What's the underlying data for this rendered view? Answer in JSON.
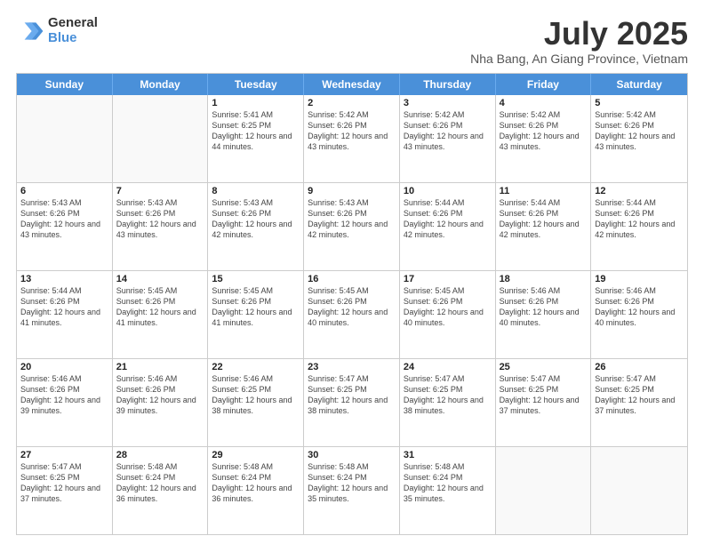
{
  "logo": {
    "line1": "General",
    "line2": "Blue"
  },
  "title": "July 2025",
  "subtitle": "Nha Bang, An Giang Province, Vietnam",
  "weekdays": [
    "Sunday",
    "Monday",
    "Tuesday",
    "Wednesday",
    "Thursday",
    "Friday",
    "Saturday"
  ],
  "weeks": [
    [
      {
        "day": "",
        "info": ""
      },
      {
        "day": "",
        "info": ""
      },
      {
        "day": "1",
        "info": "Sunrise: 5:41 AM\nSunset: 6:25 PM\nDaylight: 12 hours and 44 minutes."
      },
      {
        "day": "2",
        "info": "Sunrise: 5:42 AM\nSunset: 6:26 PM\nDaylight: 12 hours and 43 minutes."
      },
      {
        "day": "3",
        "info": "Sunrise: 5:42 AM\nSunset: 6:26 PM\nDaylight: 12 hours and 43 minutes."
      },
      {
        "day": "4",
        "info": "Sunrise: 5:42 AM\nSunset: 6:26 PM\nDaylight: 12 hours and 43 minutes."
      },
      {
        "day": "5",
        "info": "Sunrise: 5:42 AM\nSunset: 6:26 PM\nDaylight: 12 hours and 43 minutes."
      }
    ],
    [
      {
        "day": "6",
        "info": "Sunrise: 5:43 AM\nSunset: 6:26 PM\nDaylight: 12 hours and 43 minutes."
      },
      {
        "day": "7",
        "info": "Sunrise: 5:43 AM\nSunset: 6:26 PM\nDaylight: 12 hours and 43 minutes."
      },
      {
        "day": "8",
        "info": "Sunrise: 5:43 AM\nSunset: 6:26 PM\nDaylight: 12 hours and 42 minutes."
      },
      {
        "day": "9",
        "info": "Sunrise: 5:43 AM\nSunset: 6:26 PM\nDaylight: 12 hours and 42 minutes."
      },
      {
        "day": "10",
        "info": "Sunrise: 5:44 AM\nSunset: 6:26 PM\nDaylight: 12 hours and 42 minutes."
      },
      {
        "day": "11",
        "info": "Sunrise: 5:44 AM\nSunset: 6:26 PM\nDaylight: 12 hours and 42 minutes."
      },
      {
        "day": "12",
        "info": "Sunrise: 5:44 AM\nSunset: 6:26 PM\nDaylight: 12 hours and 42 minutes."
      }
    ],
    [
      {
        "day": "13",
        "info": "Sunrise: 5:44 AM\nSunset: 6:26 PM\nDaylight: 12 hours and 41 minutes."
      },
      {
        "day": "14",
        "info": "Sunrise: 5:45 AM\nSunset: 6:26 PM\nDaylight: 12 hours and 41 minutes."
      },
      {
        "day": "15",
        "info": "Sunrise: 5:45 AM\nSunset: 6:26 PM\nDaylight: 12 hours and 41 minutes."
      },
      {
        "day": "16",
        "info": "Sunrise: 5:45 AM\nSunset: 6:26 PM\nDaylight: 12 hours and 40 minutes."
      },
      {
        "day": "17",
        "info": "Sunrise: 5:45 AM\nSunset: 6:26 PM\nDaylight: 12 hours and 40 minutes."
      },
      {
        "day": "18",
        "info": "Sunrise: 5:46 AM\nSunset: 6:26 PM\nDaylight: 12 hours and 40 minutes."
      },
      {
        "day": "19",
        "info": "Sunrise: 5:46 AM\nSunset: 6:26 PM\nDaylight: 12 hours and 40 minutes."
      }
    ],
    [
      {
        "day": "20",
        "info": "Sunrise: 5:46 AM\nSunset: 6:26 PM\nDaylight: 12 hours and 39 minutes."
      },
      {
        "day": "21",
        "info": "Sunrise: 5:46 AM\nSunset: 6:26 PM\nDaylight: 12 hours and 39 minutes."
      },
      {
        "day": "22",
        "info": "Sunrise: 5:46 AM\nSunset: 6:25 PM\nDaylight: 12 hours and 38 minutes."
      },
      {
        "day": "23",
        "info": "Sunrise: 5:47 AM\nSunset: 6:25 PM\nDaylight: 12 hours and 38 minutes."
      },
      {
        "day": "24",
        "info": "Sunrise: 5:47 AM\nSunset: 6:25 PM\nDaylight: 12 hours and 38 minutes."
      },
      {
        "day": "25",
        "info": "Sunrise: 5:47 AM\nSunset: 6:25 PM\nDaylight: 12 hours and 37 minutes."
      },
      {
        "day": "26",
        "info": "Sunrise: 5:47 AM\nSunset: 6:25 PM\nDaylight: 12 hours and 37 minutes."
      }
    ],
    [
      {
        "day": "27",
        "info": "Sunrise: 5:47 AM\nSunset: 6:25 PM\nDaylight: 12 hours and 37 minutes."
      },
      {
        "day": "28",
        "info": "Sunrise: 5:48 AM\nSunset: 6:24 PM\nDaylight: 12 hours and 36 minutes."
      },
      {
        "day": "29",
        "info": "Sunrise: 5:48 AM\nSunset: 6:24 PM\nDaylight: 12 hours and 36 minutes."
      },
      {
        "day": "30",
        "info": "Sunrise: 5:48 AM\nSunset: 6:24 PM\nDaylight: 12 hours and 35 minutes."
      },
      {
        "day": "31",
        "info": "Sunrise: 5:48 AM\nSunset: 6:24 PM\nDaylight: 12 hours and 35 minutes."
      },
      {
        "day": "",
        "info": ""
      },
      {
        "day": "",
        "info": ""
      }
    ]
  ]
}
